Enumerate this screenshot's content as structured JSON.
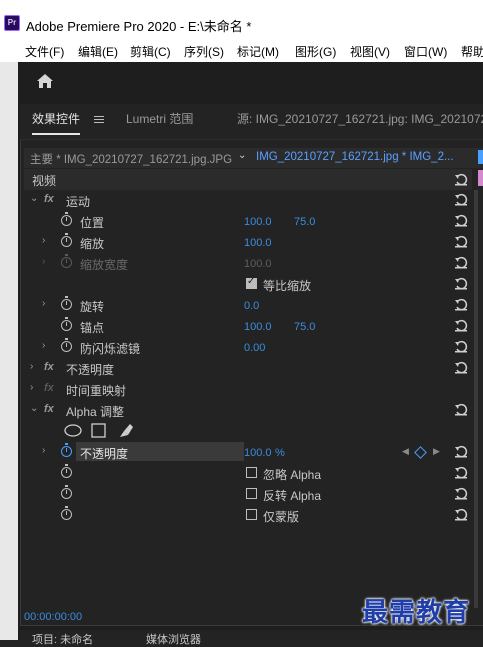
{
  "window": {
    "app_icon": "Pr",
    "title": "Adobe Premiere Pro 2020 - E:\\未命名 *"
  },
  "menu": [
    "文件(F)",
    "编辑(E)",
    "剪辑(C)",
    "序列(S)",
    "标记(M)",
    "图形(G)",
    "视图(V)",
    "窗口(W)",
    "帮助"
  ],
  "home_icon": "home-icon",
  "tabs": {
    "effect_controls": "效果控件",
    "lumetri": "Lumetri 范围",
    "source": "源: IMG_20210727_162721.jpg: IMG_20210727_"
  },
  "clip_bar": {
    "master": "主要 * IMG_20210727_162721.jpg.JPG",
    "sequence": "IMG_20210727_162721.jpg * IMG_2..."
  },
  "video_header": "视频",
  "motion": {
    "label": "运动",
    "position": {
      "label": "位置",
      "x": "100.0",
      "y": "75.0"
    },
    "scale": {
      "label": "缩放",
      "value": "100.0"
    },
    "scale_width": {
      "label": "缩放宽度",
      "value": "100.0"
    },
    "uniform_scale": {
      "label": "等比缩放",
      "checked": true
    },
    "rotation": {
      "label": "旋转",
      "value": "0.0"
    },
    "anchor": {
      "label": "锚点",
      "x": "100.0",
      "y": "75.0"
    },
    "anti_flicker": {
      "label": "防闪烁滤镜",
      "value": "0.00"
    }
  },
  "opacity_effect": "不透明度",
  "time_remap": "时间重映射",
  "alpha_adjust": {
    "label": "Alpha 调整",
    "opacity": {
      "label": "不透明度",
      "value": "100.0",
      "unit": "%"
    },
    "ignore_alpha": {
      "label": "忽略 Alpha",
      "checked": false
    },
    "invert_alpha": {
      "label": "反转 Alpha",
      "checked": false
    },
    "mask_only": {
      "label": "仅蒙版",
      "checked": false
    }
  },
  "timecode": "00:00:00:00",
  "bottom_tabs": [
    "项目: 未命名",
    "媒体浏览器"
  ],
  "watermark": "最需教育",
  "colors": {
    "accent": "#3a8dde",
    "panel": "#232323",
    "watermark": "#1f3ea8"
  }
}
